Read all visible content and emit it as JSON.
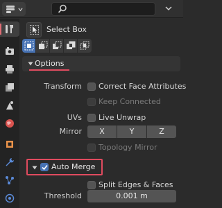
{
  "header": {
    "search": {
      "placeholder": "",
      "value": ""
    }
  },
  "tabs": [
    {
      "icon": "tool-icon",
      "active": true
    },
    {
      "icon": "render-icon"
    },
    {
      "icon": "output-icon"
    },
    {
      "icon": "view-layer-icon"
    },
    {
      "icon": "scene-icon"
    },
    {
      "icon": "world-icon"
    },
    {
      "icon": "object-icon"
    },
    {
      "icon": "modifier-icon"
    },
    {
      "icon": "particles-icon"
    },
    {
      "icon": "physics-icon"
    }
  ],
  "tool": {
    "name": "Select Box"
  },
  "options": {
    "title": "Options",
    "transform_label": "Transform",
    "correct_face_attributes": {
      "label": "Correct Face Attributes",
      "checked": false
    },
    "keep_connected": {
      "label": "Keep Connected",
      "checked": false,
      "disabled": true
    },
    "uvs_label": "UVs",
    "live_unwrap": {
      "label": "Live Unwrap",
      "checked": false
    },
    "mirror_label": "Mirror",
    "mirror_axes": [
      "X",
      "Y",
      "Z"
    ],
    "topology_mirror": {
      "label": "Topology Mirror",
      "checked": false,
      "disabled": true
    }
  },
  "auto_merge": {
    "label": "Auto Merge",
    "checked": true,
    "split_edges_faces": {
      "label": "Split Edges & Faces",
      "checked": false
    },
    "threshold_label": "Threshold",
    "threshold_value": "0.001 m"
  },
  "colors": {
    "accent_blue": "#4772b3",
    "highlight_red": "#e04b5f"
  }
}
